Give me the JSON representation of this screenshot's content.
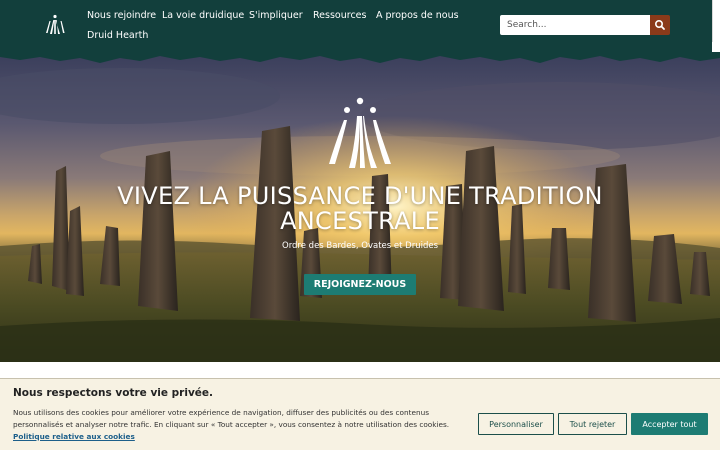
{
  "nav": {
    "items": [
      {
        "label": "Nous rejoindre"
      },
      {
        "label": "La voie druidique"
      },
      {
        "label": "S'impliquer"
      },
      {
        "label": "Ressources"
      },
      {
        "label": "A propos de nous"
      },
      {
        "label": "Druid Hearth"
      }
    ]
  },
  "search": {
    "placeholder": "Search..."
  },
  "hero": {
    "title": "VIVEZ LA PUISSANCE D'UNE TRADITION ANCESTRALE",
    "subtitle": "Ordre des Bardes, Ovates et Druides",
    "cta_label": "REJOIGNEZ-NOUS"
  },
  "cookie": {
    "title": "Nous respectons votre vie privée.",
    "text": "Nous utilisons des cookies pour améliorer votre expérience de navigation, diffuser des publicités ou des contenus personnalisés et analyser notre trafic. En cliquant sur « Tout accepter », vous consentez à notre utilisation des cookies.",
    "policy_link": "Politique relative aux cookies",
    "customize_label": "Personnaliser",
    "reject_label": "Tout rejeter",
    "accept_label": "Accepter tout"
  },
  "icons": {
    "logo": "awen-logo-icon",
    "search": "search-icon",
    "emblem": "awen-emblem-icon"
  },
  "colors": {
    "header_bg": "#123f3c",
    "accent_teal": "#1d7c73",
    "search_button": "#8b3a1a",
    "cookie_bg": "#f7f2e3"
  }
}
